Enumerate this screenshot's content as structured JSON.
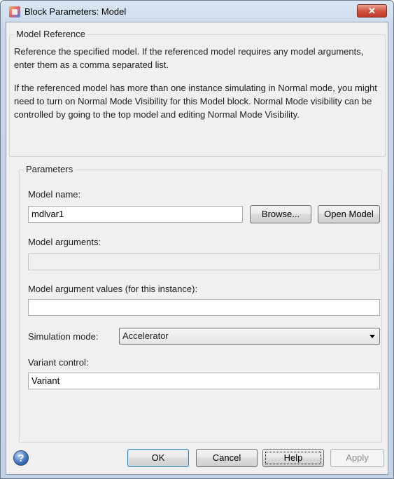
{
  "window": {
    "title": "Block Parameters: Model",
    "close_glyph": "✕"
  },
  "reference_group": {
    "title": "Model Reference",
    "description_1": "Reference the specified model. If the referenced model requires any model arguments, enter them as a comma separated list.",
    "description_2": "If the referenced model has more than one instance simulating in Normal mode, you might need to turn on Normal Mode Visibility for this Model block. Normal Mode visibility can be controlled by going to the top model and editing Normal Mode Visibility."
  },
  "parameters": {
    "title": "Parameters",
    "model_name_label": "Model name:",
    "model_name_value": "mdlvar1",
    "browse_label": "Browse...",
    "open_model_label": "Open Model",
    "model_arguments_label": "Model arguments:",
    "model_arguments_value": "",
    "argument_values_label": "Model argument values (for this instance):",
    "argument_values_value": "",
    "simulation_mode_label": "Simulation mode:",
    "simulation_mode_value": "Accelerator",
    "variant_control_label": "Variant control:",
    "variant_control_value": "Variant"
  },
  "footer": {
    "help_icon_glyph": "?",
    "ok_label": "OK",
    "cancel_label": "Cancel",
    "help_label": "Help",
    "apply_label": "Apply"
  }
}
